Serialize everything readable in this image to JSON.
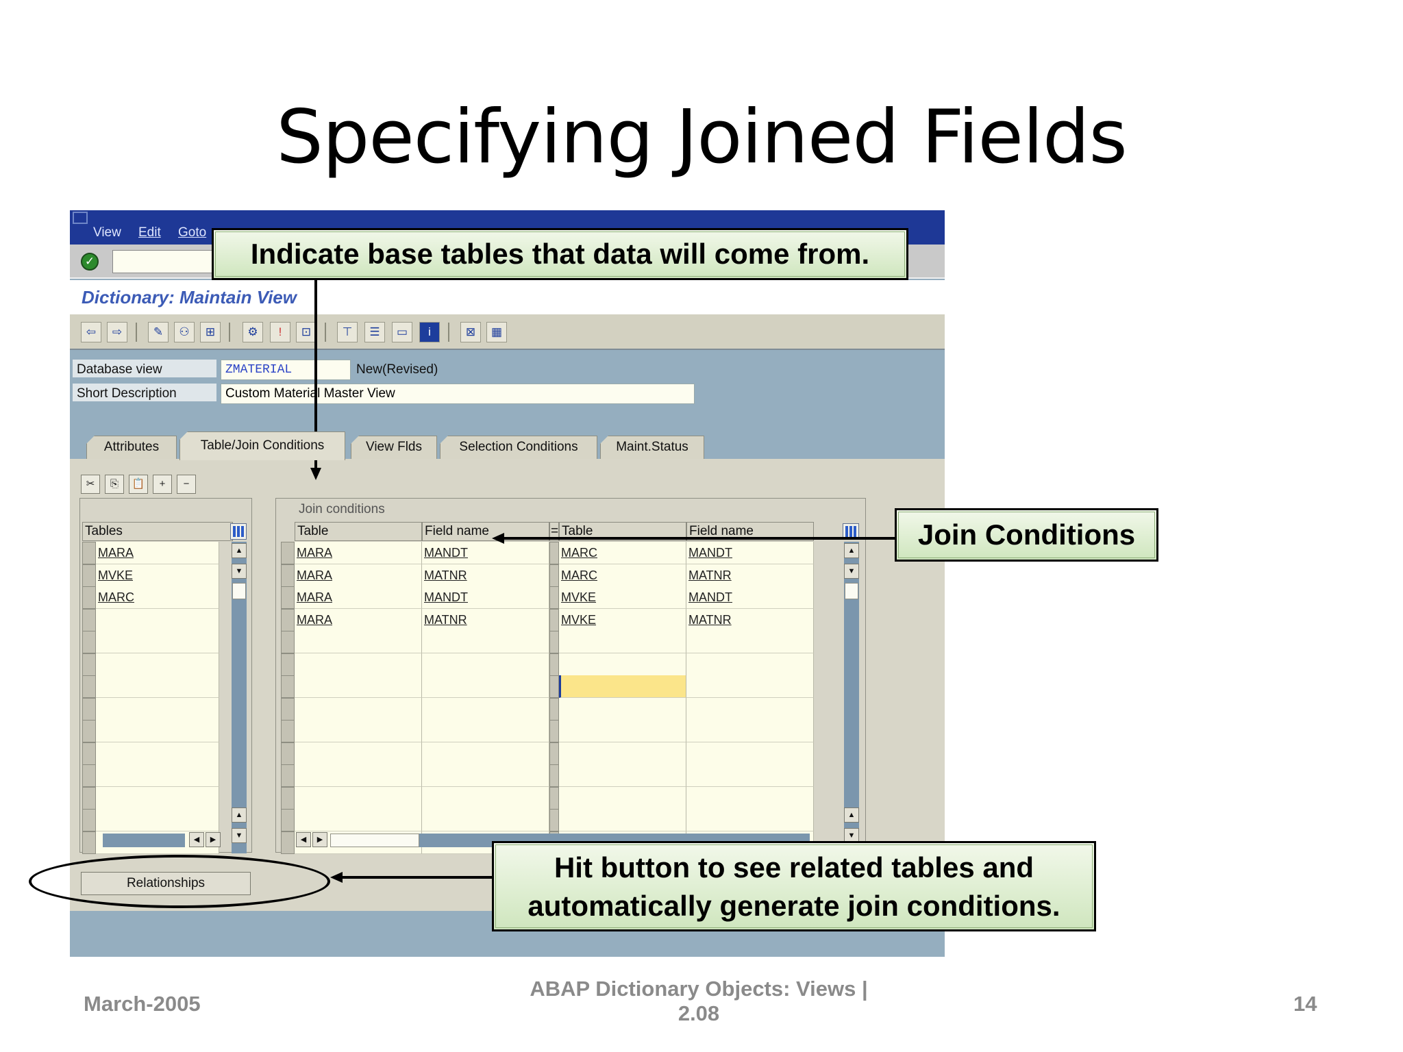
{
  "slide": {
    "title": "Specifying Joined Fields",
    "footer_left": "March-2005",
    "footer_center_line1": "ABAP Dictionary Objects:  Views |",
    "footer_center_line2": "2.08",
    "footer_page": "14"
  },
  "sap": {
    "menu": {
      "view": "View",
      "edit": "Edit",
      "goto": "Goto"
    },
    "window_title": "Dictionary: Maintain View",
    "fields": {
      "database_view_label": "Database view",
      "database_view_value": "ZMATERIAL",
      "status": "New(Revised)",
      "short_desc_label": "Short Description",
      "short_desc_value": "Custom Material Master View"
    },
    "tabs": [
      "Attributes",
      "Table/Join Conditions",
      "View Flds",
      "Selection Conditions",
      "Maint.Status"
    ],
    "tables_grid": {
      "header": "Tables",
      "rows": [
        "MARA",
        "MVKE",
        "MARC"
      ]
    },
    "join_grid": {
      "title": "Join conditions",
      "headers": [
        "Table",
        "Field name",
        "=",
        "Table",
        "Field name"
      ],
      "rows": [
        [
          "MARA",
          "MANDT",
          "MARC",
          "MANDT"
        ],
        [
          "MARA",
          "MATNR",
          "MARC",
          "MATNR"
        ],
        [
          "MARA",
          "MANDT",
          "MVKE",
          "MANDT"
        ],
        [
          "MARA",
          "MATNR",
          "MVKE",
          "MATNR"
        ]
      ]
    },
    "relationships_button": "Relationships"
  },
  "callouts": {
    "base_tables": "Indicate base tables that data will come from.",
    "join_conditions": "Join Conditions",
    "hit_button_line1": "Hit button to see related tables and",
    "hit_button_line2": "automatically generate join conditions."
  },
  "colors": {
    "menubar": "#1e3896",
    "title_text": "#3c5bb6",
    "background_blue": "#95aebf",
    "callout_green": "#d9ecc9",
    "cell_yellow": "#fdfde9",
    "active_cell": "#fbe58a"
  }
}
